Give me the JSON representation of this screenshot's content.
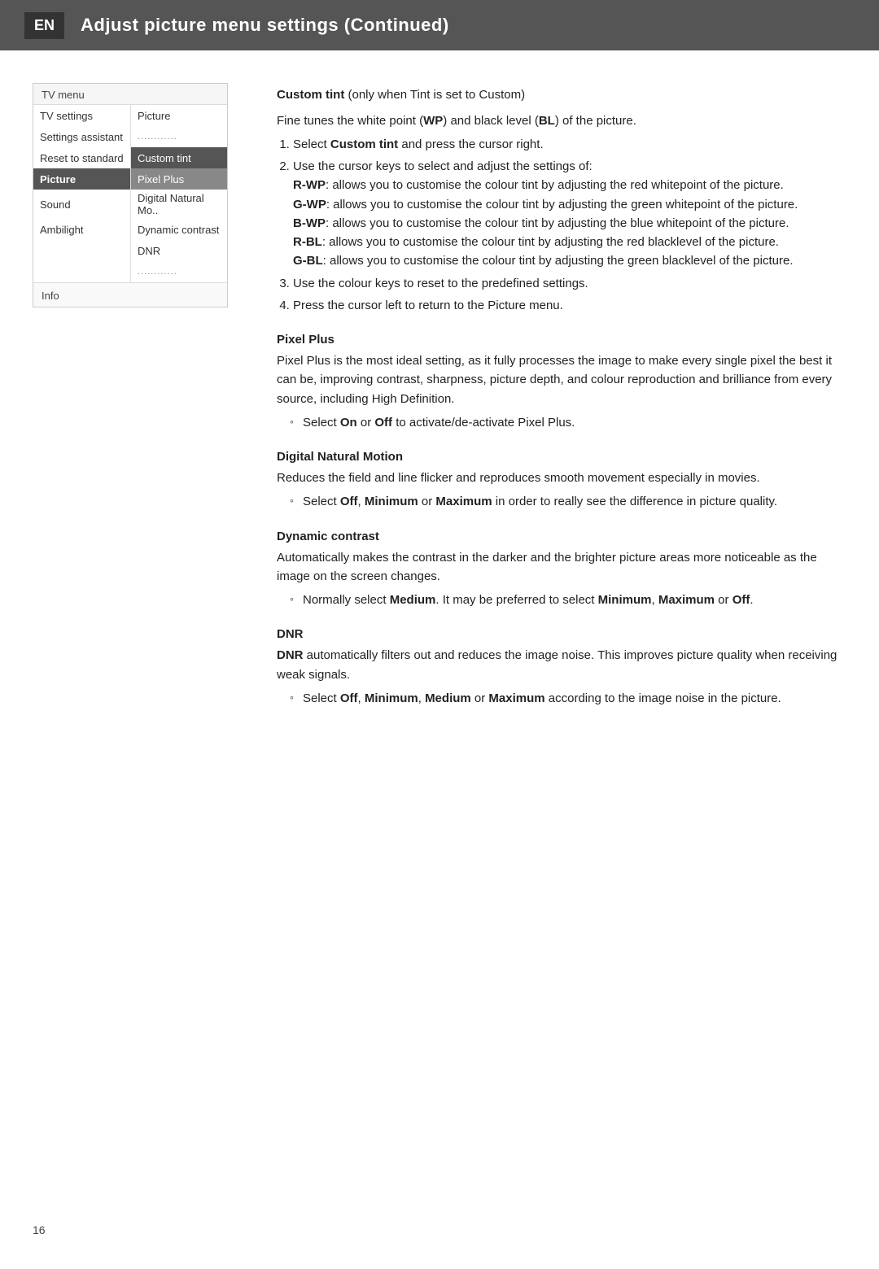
{
  "header": {
    "en_label": "EN",
    "title": "Adjust picture menu settings  (Continued)"
  },
  "tv_menu": {
    "title": "TV menu",
    "rows": [
      {
        "left": "TV settings",
        "right": "Picture",
        "style": ""
      },
      {
        "left": "Settings assistant",
        "right": "............",
        "style": "separator-right"
      },
      {
        "left": "Reset to standard",
        "right": "Custom tint",
        "style": "highlight-right"
      },
      {
        "left": "Picture",
        "right": "Pixel Plus",
        "style": "highlight-left selected-right"
      },
      {
        "left": "Sound",
        "right": "Digital Natural Mo..",
        "style": ""
      },
      {
        "left": "Ambilight",
        "right": "Dynamic contrast",
        "style": ""
      },
      {
        "left": "",
        "right": "DNR",
        "style": ""
      },
      {
        "left": "",
        "right": "............",
        "style": "separator-right"
      }
    ],
    "info": "Info"
  },
  "sections": [
    {
      "id": "custom-tint",
      "title": "Custom tint",
      "title_suffix": "  (only when Tint is set to Custom)",
      "intro": "Fine tunes the white point (WP) and black level (BL) of the picture.",
      "steps": [
        "Select <b>Custom tint</b> and press the cursor right.",
        "Use the cursor keys to select and adjust the settings of: <b>R-WP</b>: allows you to customise the colour tint by adjusting the red whitepoint of the picture. <b>G-WP</b>: allows you to customise the colour tint by adjusting the green whitepoint of the picture. <b>B-WP</b>: allows you to customise the colour tint by adjusting the blue whitepoint of the picture. <b>R-BL</b>: allows you to customise the colour tint by adjusting the red blacklevel of the picture. <b>G-BL</b>: allows you to customise the colour tint by adjusting the green blacklevel of the picture.",
        "Use the colour keys to reset to the predefined settings.",
        "Press the cursor left to return to the Picture menu."
      ]
    },
    {
      "id": "pixel-plus",
      "title": "Pixel Plus",
      "body": "Pixel Plus is the most ideal setting, as it fully processes the image to make every single pixel the best it can be, improving contrast, sharpness, picture depth, and colour reproduction and brilliance from every source, including High Definition.",
      "bullets": [
        "Select <b>On</b> or <b>Off</b> to activate/de-activate Pixel Plus."
      ]
    },
    {
      "id": "digital-natural-motion",
      "title": "Digital Natural Motion",
      "body": "Reduces the field and line flicker and reproduces smooth movement especially in movies.",
      "bullets": [
        "Select <b>Off</b>, <b>Minimum</b> or <b>Maximum</b> in order to really see the difference in picture quality."
      ]
    },
    {
      "id": "dynamic-contrast",
      "title": "Dynamic contrast",
      "body": "Automatically makes the contrast in the darker and the brighter picture areas more noticeable as the image on the screen changes.",
      "bullets": [
        "Normally select <b>Medium</b>. It may be preferred to select <b>Minimum</b>, <b>Maximum</b> or <b>Off</b>."
      ]
    },
    {
      "id": "dnr",
      "title": "DNR",
      "body": "<b>DNR</b> automatically filters out and reduces the image noise. This improves picture quality when receiving weak signals.",
      "bullets": [
        "Select <b>Off</b>, <b>Minimum</b>, <b>Medium</b> or <b>Maximum</b> according to the image noise in the picture."
      ]
    }
  ],
  "page_number": "16"
}
